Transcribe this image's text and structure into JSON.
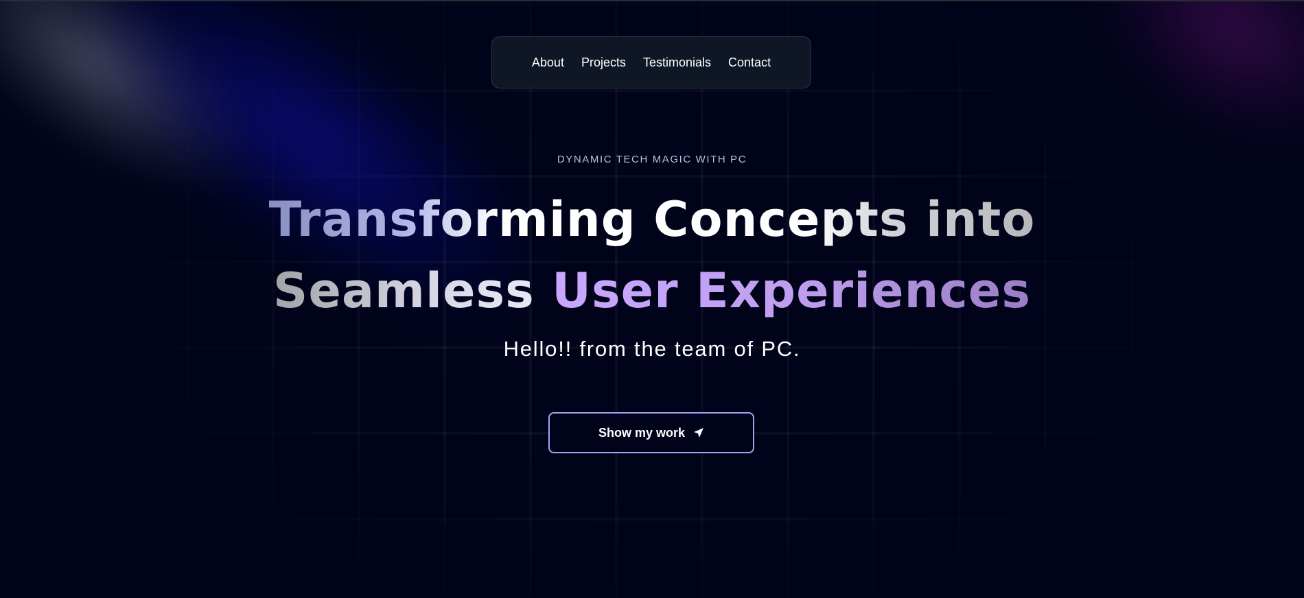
{
  "nav": {
    "items": [
      {
        "label": "About"
      },
      {
        "label": "Projects"
      },
      {
        "label": "Testimonials"
      },
      {
        "label": "Contact"
      }
    ]
  },
  "hero": {
    "eyebrow": "DYNAMIC TECH MAGIC WITH PC",
    "headline_line1": "Transforming Concepts into",
    "headline_line2_plain": "Seamless",
    "headline_line2_accent": "User Experiences",
    "subtitle": "Hello!! from the team of PC.",
    "cta_label": "Show my work",
    "cta_icon": "paper-plane-icon"
  },
  "colors": {
    "background": "#000319",
    "accent_purple": "#c8a8ff",
    "button_border": "#a8a3ef",
    "nav_background": "#111928"
  }
}
